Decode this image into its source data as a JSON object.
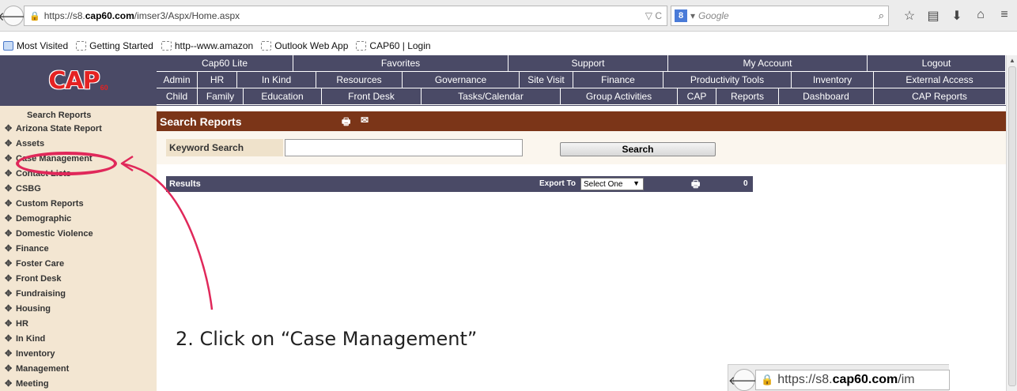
{
  "browser": {
    "url_prefix": "https://s8.",
    "url_domain": "cap60.com",
    "url_path": "/imser3/Aspx/Home.aspx",
    "url_field_icons": "▽ C",
    "search_placeholder": "Google",
    "bookmarks": [
      "Most Visited",
      "Getting Started",
      "http--www.amazon",
      "Outlook Web App",
      "CAP60 | Login"
    ]
  },
  "app": {
    "logo": "CAP",
    "logo_sub": "60",
    "nav_rows": [
      [
        "Cap60 Lite",
        "Favorites",
        "Support",
        "My Account",
        "Logout"
      ],
      [
        "Admin",
        "HR",
        "In Kind",
        "Resources",
        "Governance",
        "Site Visit",
        "Finance",
        "Productivity Tools",
        "Inventory",
        "External Access"
      ],
      [
        "Child",
        "Family",
        "Education",
        "Front Desk",
        "Tasks/Calendar",
        "Group Activities",
        "CAP",
        "Reports",
        "Dashboard",
        "CAP Reports"
      ]
    ],
    "sidebar": {
      "heading": "Search Reports",
      "items": [
        "Arizona State Report",
        "Assets",
        "Case Management",
        "Contact Lists",
        "CSBG",
        "Custom Reports",
        "Demographic",
        "Domestic Violence",
        "Finance",
        "Foster Care",
        "Front Desk",
        "Fundraising",
        "Housing",
        "HR",
        "In Kind",
        "Inventory",
        "Management",
        "Meeting"
      ]
    },
    "main": {
      "title": "Search Reports",
      "keyword_label": "Keyword Search",
      "keyword_value": "",
      "search_button": "Search",
      "results_label": "Results",
      "export_label": "Export To",
      "export_select": "Select One",
      "results_count": "0"
    }
  },
  "annotation": {
    "step_text": "2. Click on “Case Management”",
    "color": "#e0285a",
    "inset_url_prefix": "https://s8.",
    "inset_url_domain": "cap60.com",
    "inset_url_path": "/im"
  }
}
